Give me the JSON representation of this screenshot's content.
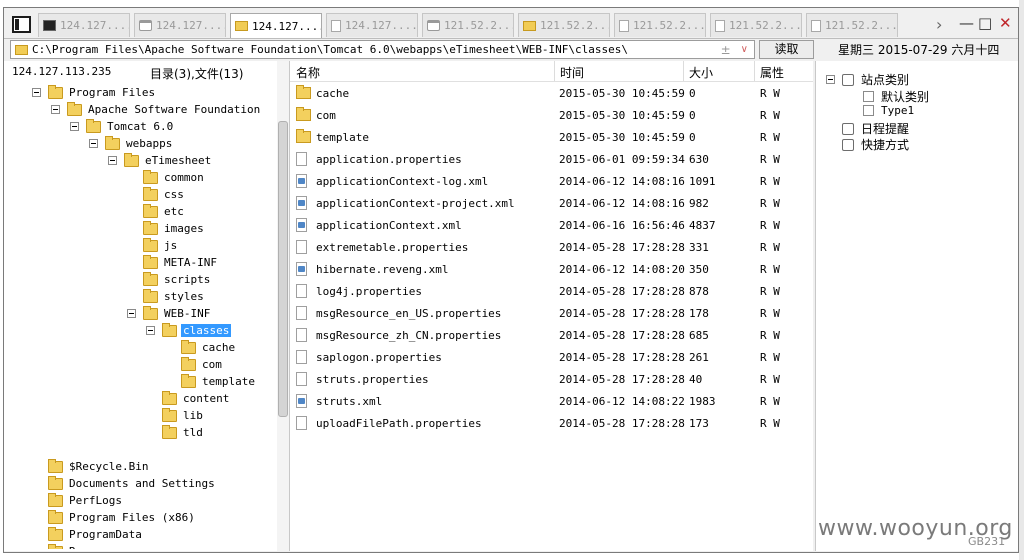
{
  "tabs": [
    {
      "label": "124.127....",
      "icon": "terminal-icon",
      "kind": "term",
      "active": false
    },
    {
      "label": "124.127....",
      "icon": "window-icon",
      "kind": "win2",
      "active": false
    },
    {
      "label": "124.127....",
      "icon": "folder-icon",
      "kind": "folder",
      "active": true
    },
    {
      "label": "124.127....",
      "icon": "document-icon",
      "kind": "doc",
      "active": false
    },
    {
      "label": "121.52.2...",
      "icon": "window-icon",
      "kind": "win2",
      "active": false
    },
    {
      "label": "121.52.2...",
      "icon": "folder-icon",
      "kind": "folder",
      "active": false
    },
    {
      "label": "121.52.2...",
      "icon": "document-icon",
      "kind": "doc",
      "active": false
    },
    {
      "label": "121.52.2...",
      "icon": "document-icon",
      "kind": "doc",
      "active": false
    },
    {
      "label": "121.52.2...",
      "icon": "document-icon",
      "kind": "doc",
      "active": false
    }
  ],
  "address": {
    "path": "C:\\Program Files\\Apache Software Foundation\\Tomcat 6.0\\webapps\\eTimesheet\\WEB-INF\\classes\\",
    "plus": "±",
    "read_label": "读取"
  },
  "date_bar": "星期三 2015-07-29 六月十四",
  "left": {
    "host": "124.127.113.235",
    "dir_count": "目录(3),文件(13)",
    "tree": [
      {
        "label": "Program Files",
        "level": 0,
        "expanded": true
      },
      {
        "label": "Apache Software Foundation",
        "level": 1,
        "expanded": true
      },
      {
        "label": "Tomcat 6.0",
        "level": 2,
        "expanded": true
      },
      {
        "label": "webapps",
        "level": 3,
        "expanded": true
      },
      {
        "label": "eTimesheet",
        "level": 4,
        "expanded": true
      },
      {
        "label": "common",
        "level": 5
      },
      {
        "label": "css",
        "level": 5
      },
      {
        "label": "etc",
        "level": 5
      },
      {
        "label": "images",
        "level": 5
      },
      {
        "label": "js",
        "level": 5
      },
      {
        "label": "META-INF",
        "level": 5
      },
      {
        "label": "scripts",
        "level": 5
      },
      {
        "label": "styles",
        "level": 5
      },
      {
        "label": "WEB-INF",
        "level": 5,
        "expanded": true
      },
      {
        "label": "classes",
        "level": 6,
        "expanded": true,
        "selected": true
      },
      {
        "label": "cache",
        "level": 7
      },
      {
        "label": "com",
        "level": 7
      },
      {
        "label": "template",
        "level": 7
      },
      {
        "label": "content",
        "level": 6
      },
      {
        "label": "lib",
        "level": 6
      },
      {
        "label": "tld",
        "level": 6
      },
      {
        "label": "",
        "level": -1
      },
      {
        "label": "$Recycle.Bin",
        "level": 0
      },
      {
        "label": "Documents and Settings",
        "level": 0
      },
      {
        "label": "PerfLogs",
        "level": 0
      },
      {
        "label": "Program Files (x86)",
        "level": 0
      },
      {
        "label": "ProgramData",
        "level": 0
      },
      {
        "label": "R",
        "level": 0
      }
    ]
  },
  "list": {
    "headers": {
      "name": "名称",
      "time": "时间",
      "size": "大小",
      "attr": "属性"
    },
    "rows": [
      {
        "name": "cache",
        "time": "2015-05-30 10:45:59",
        "size": "0",
        "attr": "R W",
        "type": "folder"
      },
      {
        "name": "com",
        "time": "2015-05-30 10:45:59",
        "size": "0",
        "attr": "R W",
        "type": "folder"
      },
      {
        "name": "template",
        "time": "2015-05-30 10:45:59",
        "size": "0",
        "attr": "R W",
        "type": "folder"
      },
      {
        "name": "application.properties",
        "time": "2015-06-01 09:59:34",
        "size": "630",
        "attr": "R W",
        "type": "file"
      },
      {
        "name": "applicationContext-log.xml",
        "time": "2014-06-12 14:08:16",
        "size": "1091",
        "attr": "R W",
        "type": "xml"
      },
      {
        "name": "applicationContext-project.xml",
        "time": "2014-06-12 14:08:16",
        "size": "982",
        "attr": "R W",
        "type": "xml"
      },
      {
        "name": "applicationContext.xml",
        "time": "2014-06-16 16:56:46",
        "size": "4837",
        "attr": "R W",
        "type": "xml"
      },
      {
        "name": "extremetable.properties",
        "time": "2014-05-28 17:28:28",
        "size": "331",
        "attr": "R W",
        "type": "file"
      },
      {
        "name": "hibernate.reveng.xml",
        "time": "2014-06-12 14:08:20",
        "size": "350",
        "attr": "R W",
        "type": "xml"
      },
      {
        "name": "log4j.properties",
        "time": "2014-05-28 17:28:28",
        "size": "878",
        "attr": "R W",
        "type": "file"
      },
      {
        "name": "msgResource_en_US.properties",
        "time": "2014-05-28 17:28:28",
        "size": "178",
        "attr": "R W",
        "type": "file"
      },
      {
        "name": "msgResource_zh_CN.properties",
        "time": "2014-05-28 17:28:28",
        "size": "685",
        "attr": "R W",
        "type": "file"
      },
      {
        "name": "saplogon.properties",
        "time": "2014-05-28 17:28:28",
        "size": "261",
        "attr": "R W",
        "type": "file"
      },
      {
        "name": "struts.properties",
        "time": "2014-05-28 17:28:28",
        "size": "40",
        "attr": "R W",
        "type": "file"
      },
      {
        "name": "struts.xml",
        "time": "2014-06-12 14:08:22",
        "size": "1983",
        "attr": "R W",
        "type": "xml"
      },
      {
        "name": "uploadFilePath.properties",
        "time": "2014-05-28 17:28:28",
        "size": "173",
        "attr": "R W",
        "type": "file"
      }
    ]
  },
  "right": {
    "site_category": "站点类别",
    "default_category": "默认类别",
    "type1": "Type1",
    "schedule": "日程提醒",
    "shortcuts": "快捷方式"
  },
  "watermark": "www.wooyun.org",
  "watermark_sub": "GB231"
}
